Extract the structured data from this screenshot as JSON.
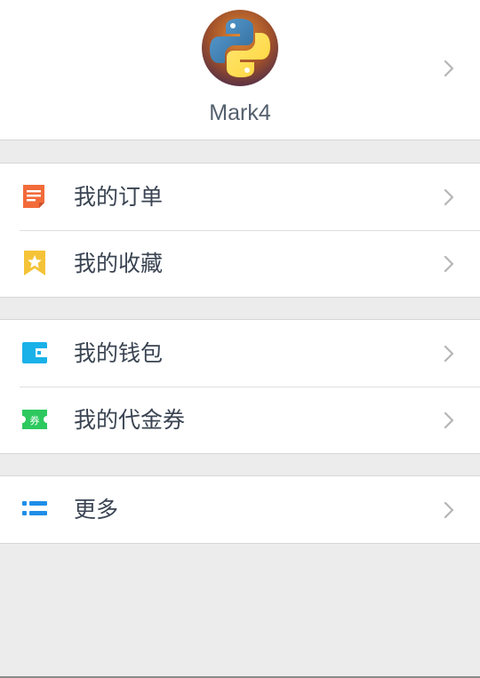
{
  "profile": {
    "username": "Mark4",
    "avatar_icon": "python-logo-icon"
  },
  "menu_groups": [
    {
      "items": [
        {
          "label": "我的订单",
          "icon": "order-icon",
          "color": "#f26b3a"
        },
        {
          "label": "我的收藏",
          "icon": "favorite-icon",
          "color": "#f5c338"
        }
      ]
    },
    {
      "items": [
        {
          "label": "我的钱包",
          "icon": "wallet-icon",
          "color": "#1ab1e8"
        },
        {
          "label": "我的代金券",
          "icon": "coupon-icon",
          "color": "#2dc95f",
          "badge": "券"
        }
      ]
    },
    {
      "items": [
        {
          "label": "更多",
          "icon": "more-list-icon",
          "color": "#1f8ee8"
        }
      ]
    }
  ],
  "colors": {
    "background": "#ececec",
    "text": "#3a4452",
    "chevron": "#b5b5b5"
  }
}
